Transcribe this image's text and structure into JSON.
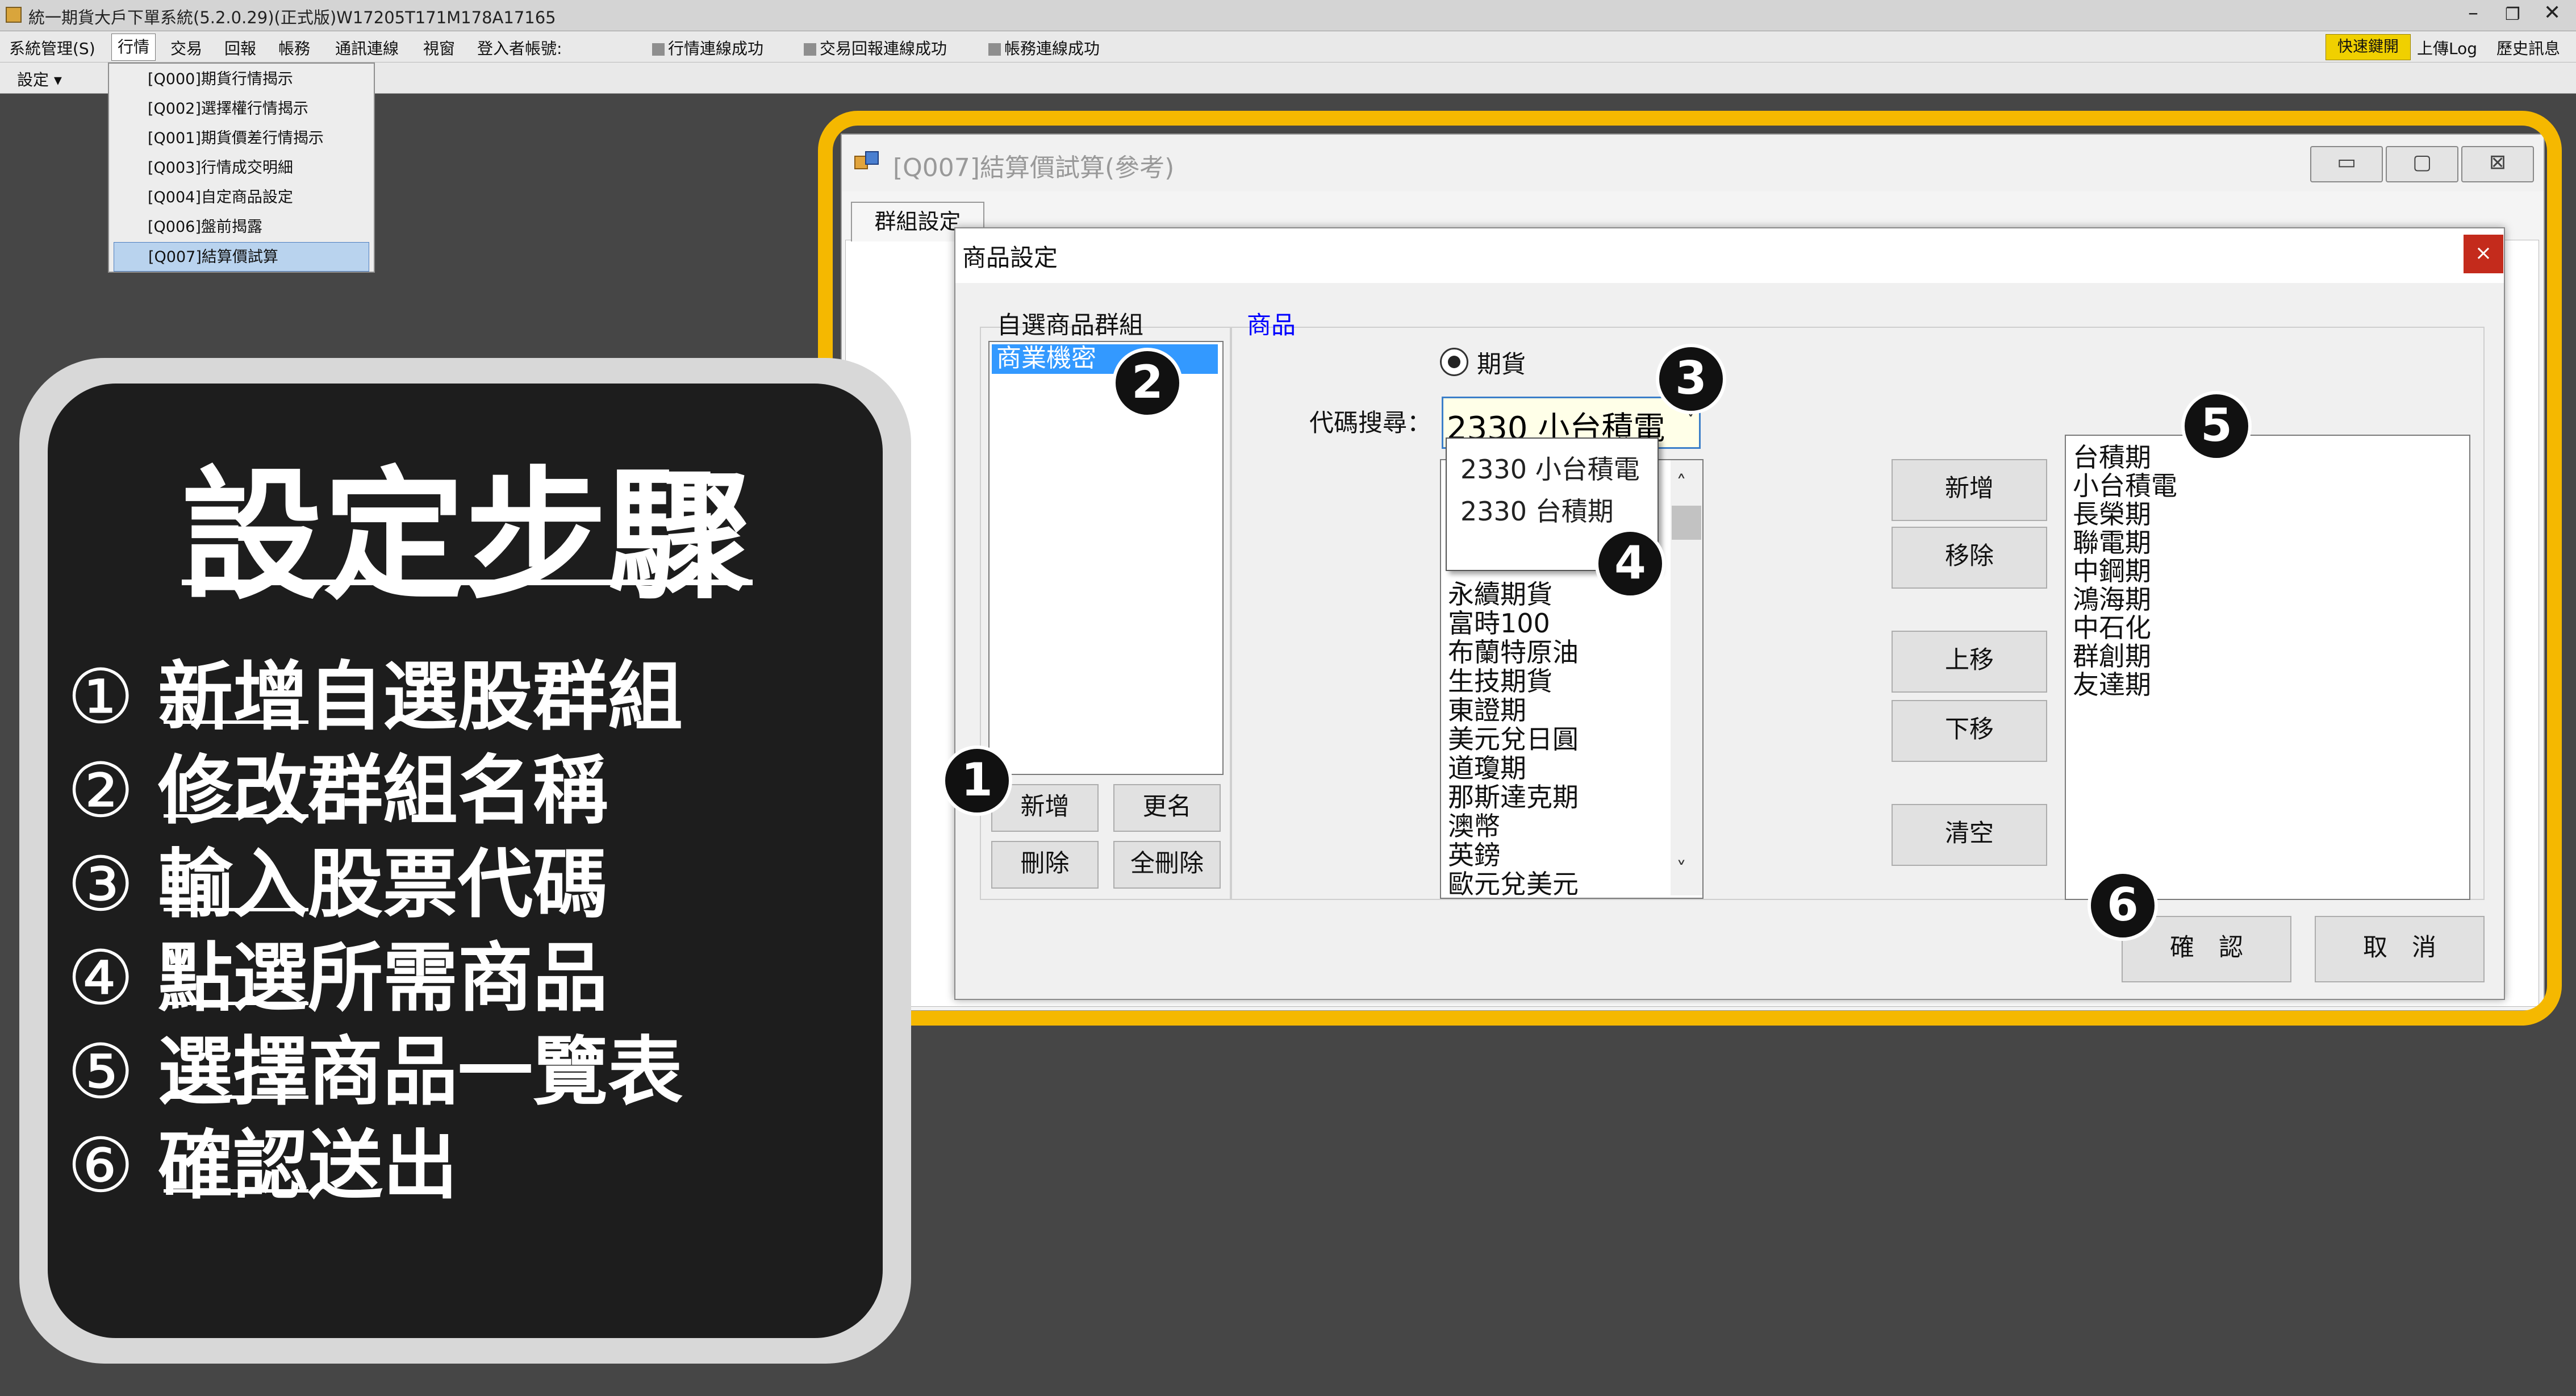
{
  "app": {
    "title": "統一期貨大戶下單系統(5.2.0.29)(正式版)W17205T171M178A17165",
    "window_controls": [
      "–",
      "❐",
      "✕"
    ]
  },
  "menubar": {
    "items": [
      "系統管理(S)",
      "行情",
      "交易",
      "回報",
      "帳務",
      "通訊連線",
      "視窗",
      "登入者帳號:"
    ],
    "status": [
      "行情連線成功",
      "交易回報連線成功",
      "帳務連線成功"
    ],
    "right": [
      "快速鍵開",
      "上傳Log",
      "歷史訊息"
    ]
  },
  "toolbar": {
    "settings": "設定 ▾"
  },
  "quote_menu": {
    "items": [
      "[Q000]期貨行情揭示",
      "[Q002]選擇權行情揭示",
      "[Q001]期貨價差行情揭示",
      "[Q003]行情成交明細",
      "[Q004]自定商品設定",
      "[Q006]盤前揭露",
      "[Q007]結算價試算"
    ],
    "selected_index": 6
  },
  "main_window": {
    "title": "[Q007]結算價試算(參考)",
    "tab": "群組設定",
    "controls": [
      "▭",
      "▢",
      "⊠"
    ]
  },
  "dialog": {
    "title": "商品設定",
    "close": "×",
    "group_label": "自選商品群組",
    "groups": [
      "商業機密"
    ],
    "group_buttons": {
      "add": "新增",
      "rename": "更名",
      "delete": "刪除",
      "delete_all": "全刪除"
    },
    "product_label": "商品",
    "radio_futures": "期貨",
    "search_label": "代碼搜尋：",
    "search_value": "2330 小台積電",
    "search_suggestions": [
      "2330 小台積電",
      "2330 台積期"
    ],
    "available_products": [
      "永續期貨",
      "富時100",
      "布蘭特原油",
      "生技期貨",
      "東證期",
      "美元兌日圓",
      "道瓊期",
      "那斯達克期",
      "澳幣",
      "英鎊",
      "歐元兌美元"
    ],
    "action_buttons": {
      "add": "新增",
      "remove": "移除",
      "up": "上移",
      "down": "下移",
      "clear": "清空"
    },
    "selected_products": [
      "台積期",
      "小台積電",
      "長榮期",
      "聯電期",
      "中鋼期",
      "鴻海期",
      "中石化",
      "群創期",
      "友達期"
    ],
    "confirm": "確　認",
    "cancel": "取　消"
  },
  "badges": [
    "1",
    "2",
    "3",
    "4",
    "5",
    "6"
  ],
  "steps": {
    "title": "設定步驟",
    "items": [
      {
        "num": "①",
        "text": "新增自選股群組"
      },
      {
        "num": "②",
        "text": "修改群組名稱"
      },
      {
        "num": "③",
        "text": "輸入股票代碼"
      },
      {
        "num": "④",
        "text": "點選所需商品"
      },
      {
        "num": "⑤",
        "text": "選擇商品一覽表"
      },
      {
        "num": "⑥",
        "text": "確認送出"
      }
    ]
  },
  "colors": {
    "highlight": "#f5b800",
    "selection": "#3399ff",
    "close": "#c42b1c",
    "quick": "#f0d000",
    "link": "#0000ff"
  }
}
